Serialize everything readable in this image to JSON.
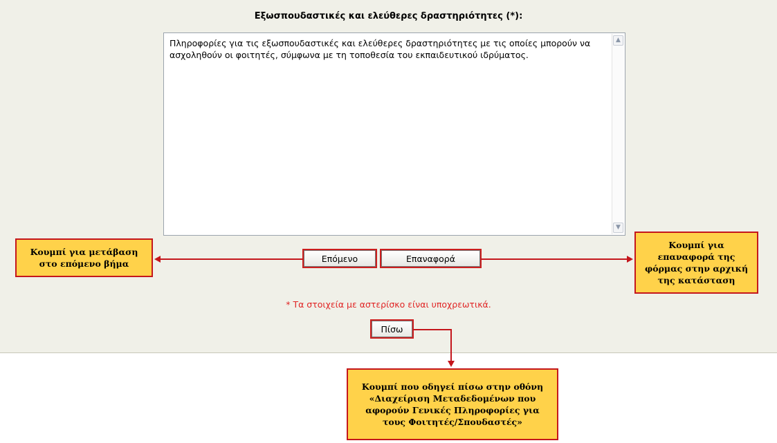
{
  "form": {
    "label": "Εξωσπουδαστικές και ελεύθερες δραστηριότητες (*):",
    "textarea_value": "Πληροφορίες για τις εξωσπουδαστικές και ελεύθερες δραστηριότητες με τις οποίες μπορούν να ασχοληθούν οι φοιτητές, σύμφωνα με τη τοποθεσία του εκπαιδευτικού ιδρύματος.",
    "next_label": "Επόμενο",
    "reset_label": "Επαναφορά",
    "required_note": "* Τα στοιχεία με αστερίσκο είναι υποχρεωτικά.",
    "back_label": "Πίσω"
  },
  "annotations": {
    "next": "Κουμπί για μετάβαση στο επόμενο βήμα",
    "reset": "Κουμπί για επαναφορά της φόρμας στην αρχική της κατάσταση",
    "back": "Κουμπί που οδηγεί πίσω στην οθόνη «Διαχείριση Μεταδεδομένων που αφορούν Γενικές Πληροφορίες για τους Φοιτητές/Σπουδαστές»"
  },
  "colors": {
    "panel_bg": "#f0f0e8",
    "callout_bg": "#ffd24a",
    "callout_border": "#c4161c",
    "required_text": "#e02424"
  }
}
